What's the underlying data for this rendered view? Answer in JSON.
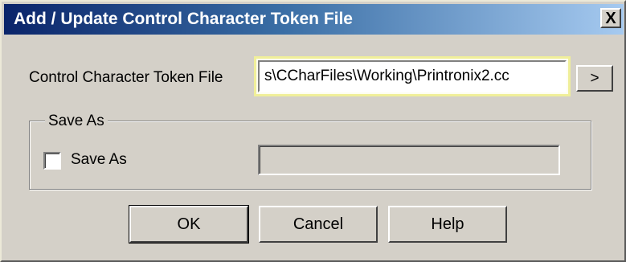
{
  "window": {
    "title": "Add / Update Control Character Token File",
    "close_label": "X"
  },
  "file_section": {
    "label": "Control Character Token File",
    "value": "s\\CCharFiles\\Working\\Printronix2.cc",
    "browse_label": ">"
  },
  "save_as_group": {
    "legend": "Save As",
    "checkbox_label": "Save As",
    "checked": false,
    "field_value": ""
  },
  "buttons": {
    "ok": "OK",
    "cancel": "Cancel",
    "help": "Help"
  }
}
